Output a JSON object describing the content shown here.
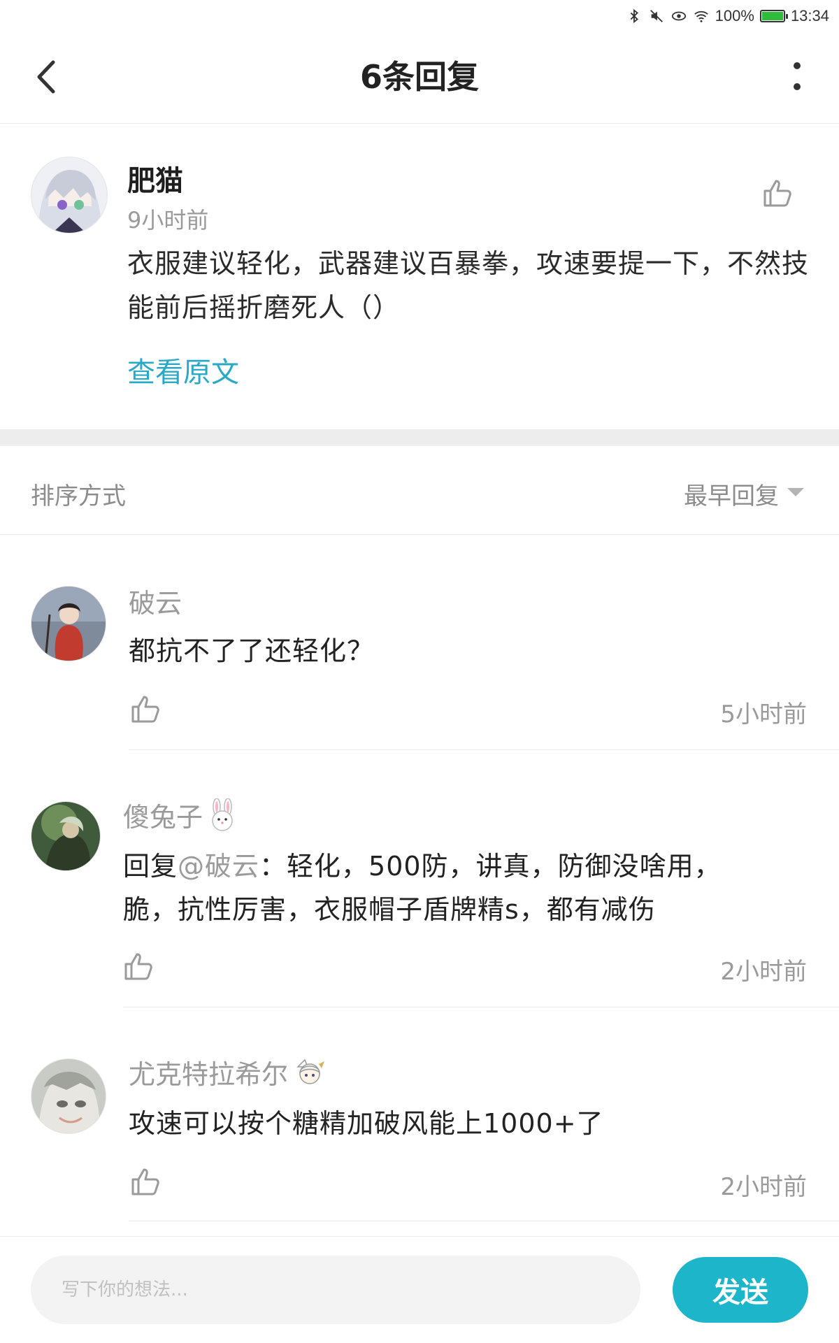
{
  "status_bar": {
    "battery": "100%",
    "battery_level": 1.0,
    "time": "13:34"
  },
  "header": {
    "title": "6条回复"
  },
  "main_comment": {
    "author": "肥猫",
    "time": "9小时前",
    "text": "衣服建议轻化，武器建议百暴拳，攻速要提一下，不然技能前后摇折磨死人（）",
    "view_original": "查看原文"
  },
  "sort": {
    "label": "排序方式",
    "value": "最早回复"
  },
  "replies": [
    {
      "author": "破云",
      "text": "都抗不了了还轻化？",
      "time": "5小时前"
    },
    {
      "author": "傻兔子",
      "reply_prefix": "回复",
      "mention": "@破云",
      "text": "：轻化，500防，讲真，防御没啥用，脆，抗性厉害，衣服帽子盾牌精s，都有减伤",
      "time": "2小时前"
    },
    {
      "author": "尤克特拉希尔",
      "text": "攻速可以按个糖精加破风能上1000+了",
      "time": "2小时前"
    }
  ],
  "composer": {
    "placeholder": "写下你的想法...",
    "send_label": "发送"
  },
  "colors": {
    "accent": "#1cb5c9",
    "link": "#29a9c5"
  }
}
